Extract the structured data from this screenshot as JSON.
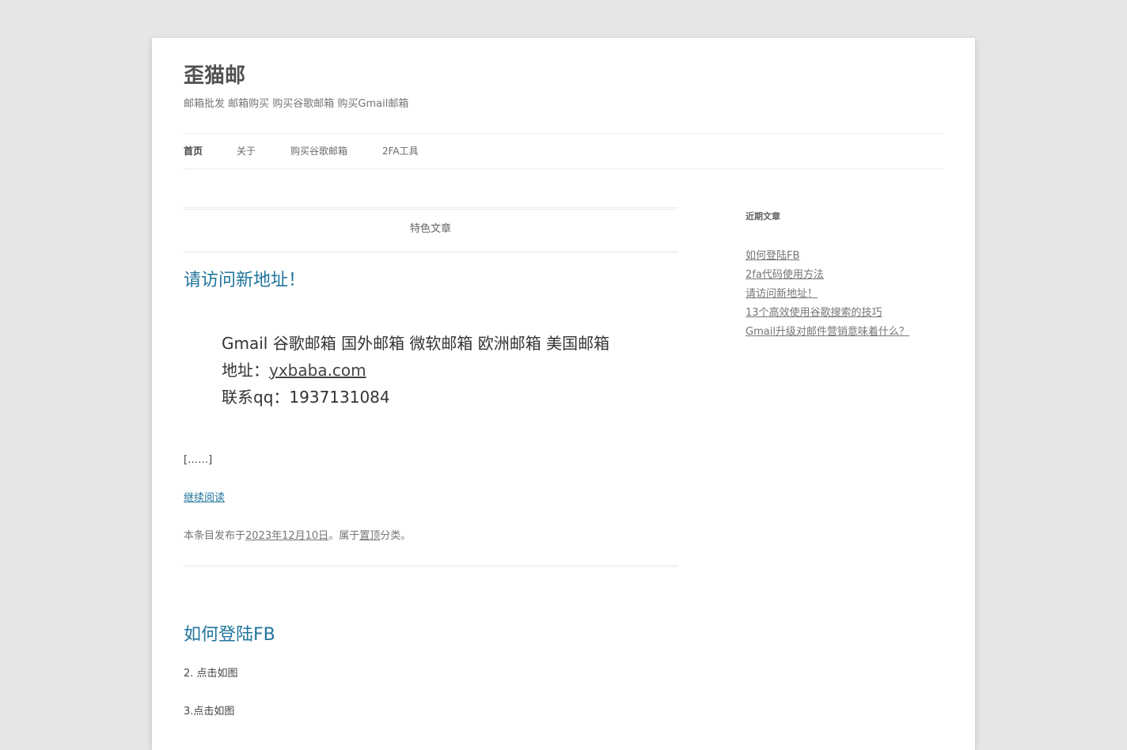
{
  "site": {
    "title": "歪猫邮",
    "description": "邮箱批发 邮箱购买 购买谷歌邮箱 购买Gmail邮箱"
  },
  "nav": {
    "items": [
      {
        "label": "首页"
      },
      {
        "label": "关于"
      },
      {
        "label": "购买谷歌邮箱"
      },
      {
        "label": "2FA工具"
      }
    ]
  },
  "featured": {
    "banner": "特色文章"
  },
  "posts": [
    {
      "title": "请访问新地址！",
      "lines": {
        "line1": "Gmail 谷歌邮箱 国外邮箱 微软邮箱 欧洲邮箱 美国邮箱",
        "line2_prefix": "地址：",
        "line2_link": "yxbaba.com",
        "line3": "联系qq：1937131084"
      },
      "excerpt_more": "[……]",
      "read_more": "继续阅读",
      "meta": {
        "prefix": "本条目发布于",
        "date": "2023年12月10日",
        "middle": "。属于",
        "category": "置顶",
        "suffix": "分类。"
      }
    },
    {
      "title": "如何登陆FB",
      "paragraphs": [
        "2. 点击如图",
        "3.点击如图"
      ]
    }
  ],
  "sidebar": {
    "widget_title": "近期文章",
    "recent_posts": [
      "如何登陆FB",
      "2fa代码使用方法",
      "请访问新地址！",
      "13个高效使用谷歌搜索的技巧",
      "Gmail升级对邮件营销意味着什么？"
    ]
  }
}
